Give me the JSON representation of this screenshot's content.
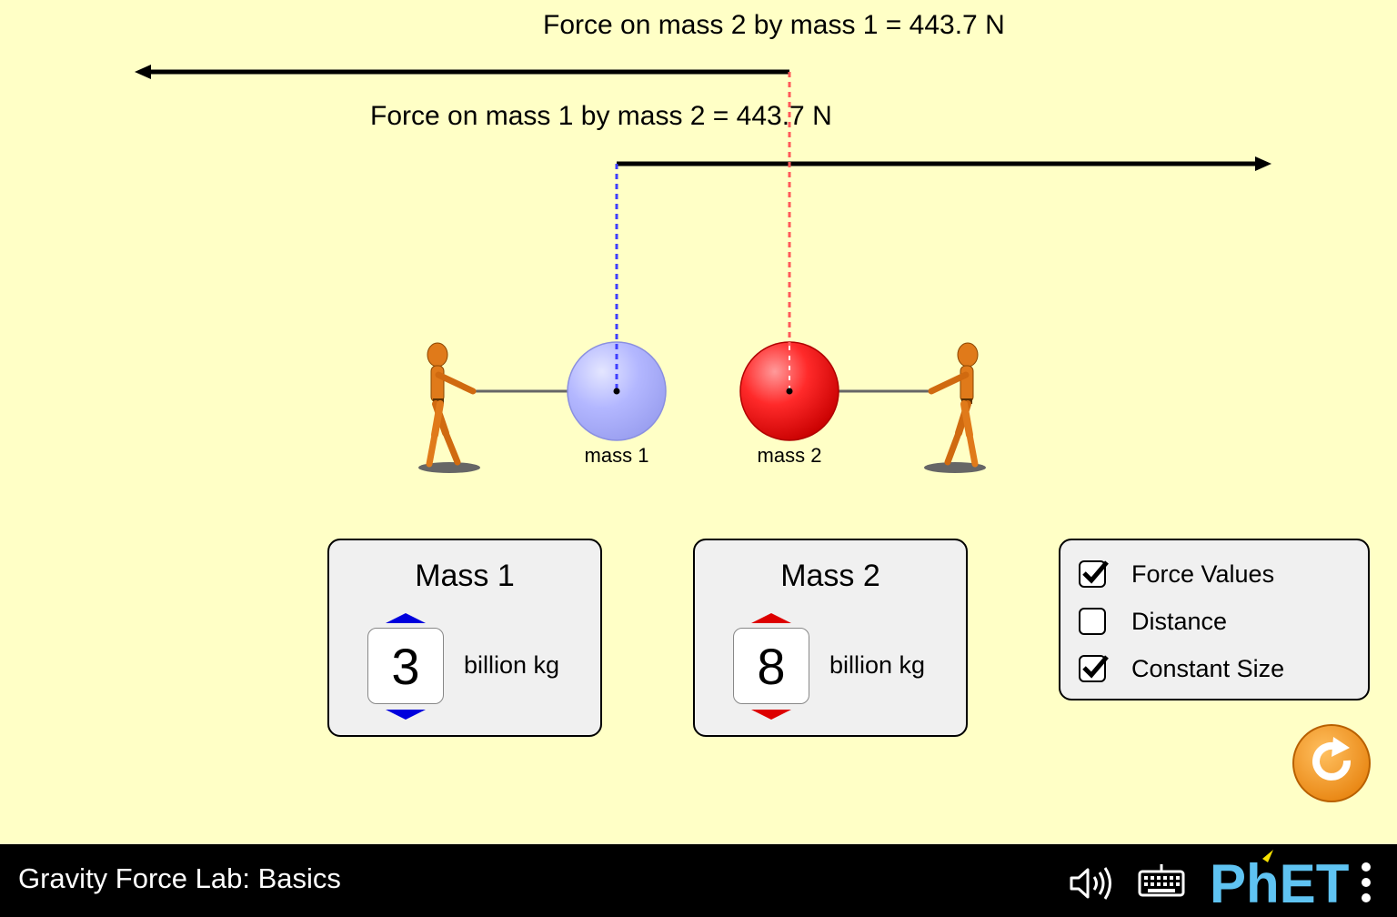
{
  "forces": {
    "on_mass2_label": "Force on mass 2 by mass 1 = 443.7 N",
    "on_mass1_label": "Force on mass 1 by mass 2 = 443.7 N"
  },
  "masses": {
    "mass1_label": "mass 1",
    "mass2_label": "mass 2",
    "mass1_color": "#b0b4ff",
    "mass2_color": "#ff2020"
  },
  "mass1_panel": {
    "title": "Mass 1",
    "value": "3",
    "unit": "billion kg",
    "accent": "#0000dd"
  },
  "mass2_panel": {
    "title": "Mass 2",
    "value": "8",
    "unit": "billion kg",
    "accent": "#dd0000"
  },
  "options": [
    {
      "label": "Force Values",
      "checked": true
    },
    {
      "label": "Distance",
      "checked": false
    },
    {
      "label": "Constant Size",
      "checked": true
    }
  ],
  "reset_icon": "reset-all-icon",
  "navbar": {
    "title": "Gravity Force Lab: Basics",
    "brand": "PhET",
    "icons": [
      "sound-icon",
      "keyboard-icon",
      "phet-logo",
      "menu-icon"
    ]
  }
}
